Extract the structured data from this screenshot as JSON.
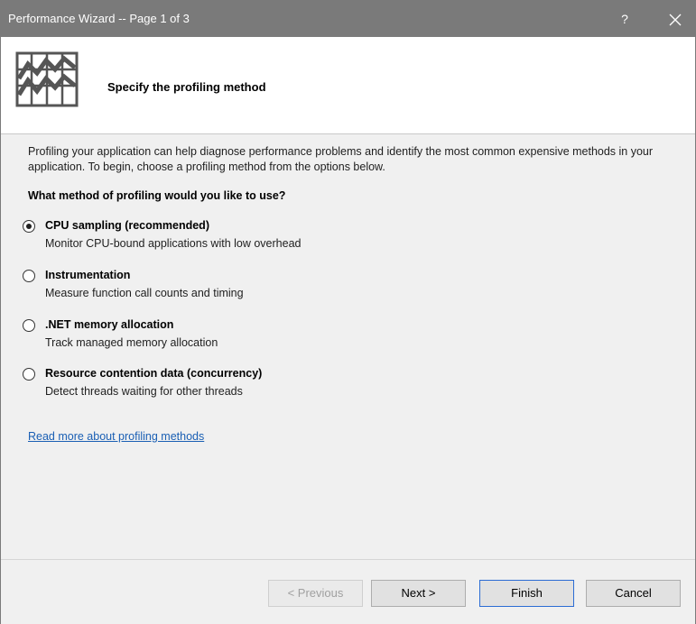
{
  "window": {
    "title": "Performance Wizard -- Page 1 of 3",
    "help_glyph": "?",
    "close_glyph": "✕"
  },
  "header": {
    "heading": "Specify the profiling method",
    "icon": "performance-chart-icon"
  },
  "content": {
    "intro": "Profiling your application can help diagnose performance problems and identify the most common expensive methods in your application. To begin, choose a profiling method from the options below.",
    "question": "What method of profiling would you like to use?",
    "options": [
      {
        "label": "CPU sampling (recommended)",
        "description": "Monitor CPU-bound applications with low overhead",
        "selected": true
      },
      {
        "label": "Instrumentation",
        "description": "Measure function call counts and timing",
        "selected": false
      },
      {
        "label": ".NET memory allocation",
        "description": "Track managed memory allocation",
        "selected": false
      },
      {
        "label": "Resource contention data (concurrency)",
        "description": "Detect threads waiting for other threads",
        "selected": false
      }
    ],
    "link": "Read more about profiling methods"
  },
  "footer": {
    "previous": "< Previous",
    "next": "Next >",
    "finish": "Finish",
    "cancel": "Cancel"
  },
  "colors": {
    "titlebar": "#7a7a7a",
    "link": "#1a5fb4",
    "default_button_border": "#2b6cd4"
  }
}
